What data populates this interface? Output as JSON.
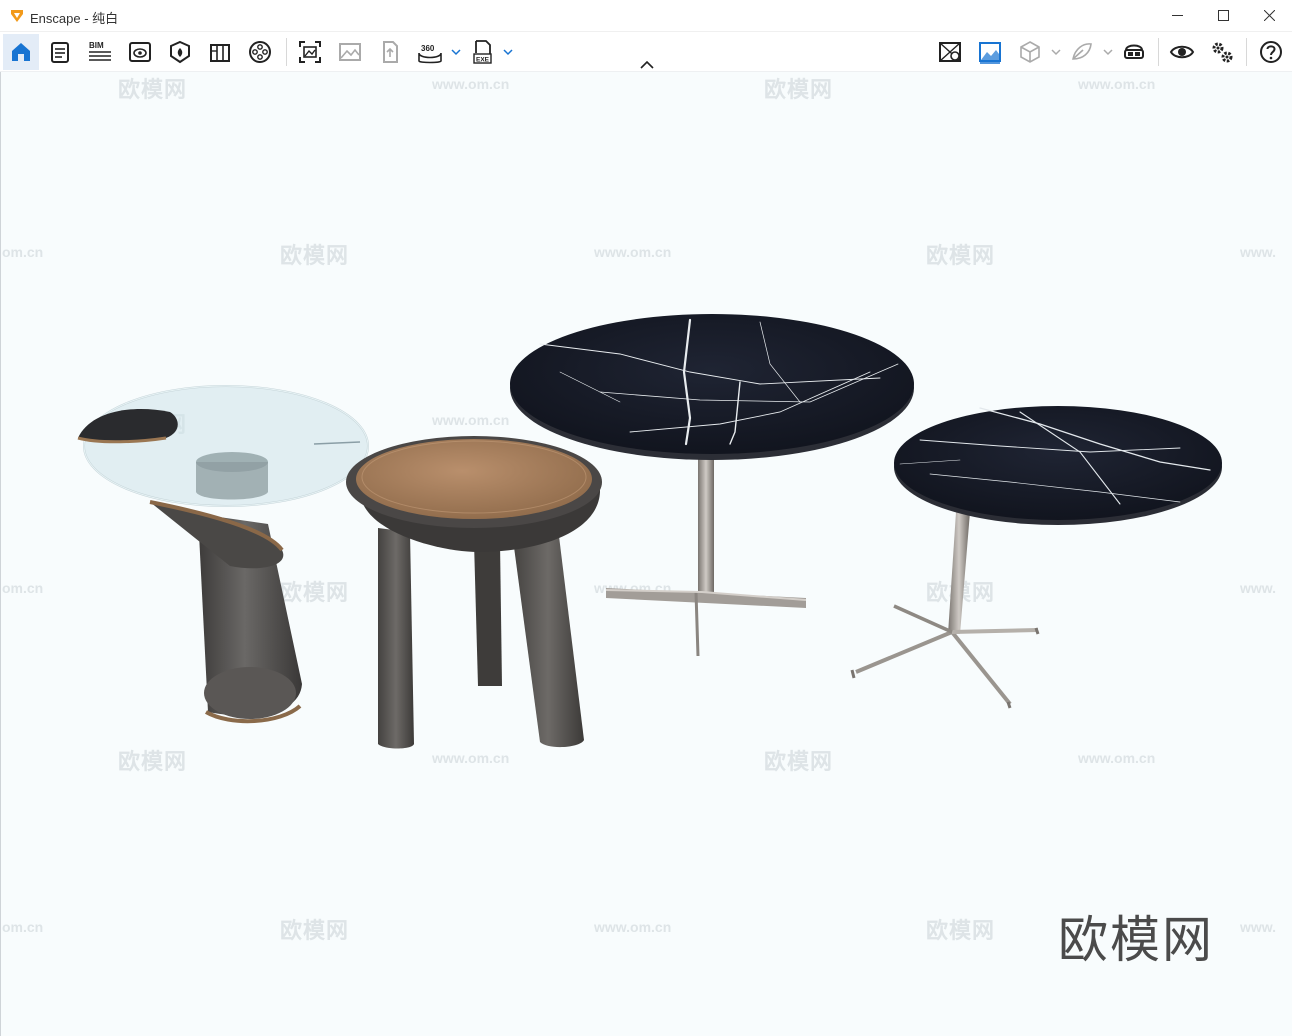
{
  "window": {
    "title": "Enscape - 纯白",
    "accent_color": "#f29a1a"
  },
  "toolbar": {
    "left_tools": [
      {
        "icon": "home-icon",
        "active": true
      },
      {
        "icon": "document-icon"
      },
      {
        "icon": "bim-icon",
        "label": "BIM"
      },
      {
        "icon": "view-management-icon"
      },
      {
        "icon": "assets-icon"
      },
      {
        "icon": "library-icon"
      },
      {
        "icon": "video-editor-icon"
      },
      {
        "icon": "screenshot-icon"
      },
      {
        "icon": "batch-render-icon"
      },
      {
        "icon": "upload-icon"
      },
      {
        "icon": "panorama-icon",
        "label": "360"
      },
      {
        "icon": "exe-export-icon",
        "label": "EXE"
      }
    ],
    "right_tools": [
      {
        "icon": "map-icon"
      },
      {
        "icon": "atmosphere-icon",
        "active": true
      },
      {
        "icon": "cube-icon"
      },
      {
        "icon": "material-icon"
      },
      {
        "icon": "vr-headset-icon"
      },
      {
        "icon": "visual-settings-icon"
      },
      {
        "icon": "settings-icon"
      },
      {
        "icon": "help-icon"
      }
    ]
  },
  "viewport": {
    "background": "#f8fcfd",
    "watermark_text": "欧模网",
    "watermark_url": "www.om.cn",
    "watermark_url_partial": "om.cn",
    "watermark_url_cut": "www.",
    "corner_logo": "欧模网",
    "objects": [
      {
        "name": "glass-side-table",
        "top": "glass",
        "base": "dark wood cylinder"
      },
      {
        "name": "leather-stool",
        "top": "brown leather",
        "base": "dark wood legs"
      },
      {
        "name": "marble-table-large",
        "top": "black marble",
        "base": "steel 4-star"
      },
      {
        "name": "marble-table-small",
        "top": "black marble",
        "base": "steel 4-star"
      }
    ]
  }
}
